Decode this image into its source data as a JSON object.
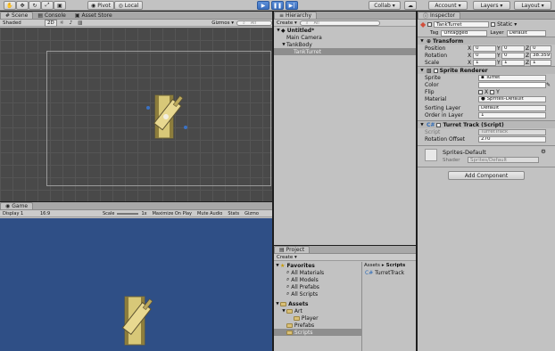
{
  "toolbar": {
    "pivot": "Pivot",
    "local": "Local",
    "collab": "Collab ▾",
    "account": "Account",
    "layers": "Layers",
    "layout": "Layout"
  },
  "scene": {
    "tab_scene": "Scene",
    "tab_console": "Console",
    "tab_asset_store": "Asset Store",
    "shading": "Shaded",
    "mode_2d": "2D",
    "gizmos": "Gizmos ▾",
    "search_placeholder": "All"
  },
  "game": {
    "tab": "Game",
    "display": "Display 1",
    "aspect": "16:9",
    "scale_label": "Scale",
    "scale_value": "1x",
    "maximize": "Maximize On Play",
    "mute": "Mute Audio",
    "stats": "Stats",
    "gizmos": "Gizmo"
  },
  "hierarchy": {
    "tab": "Hierarchy",
    "create": "Create ▾",
    "search_placeholder": "All",
    "scene_name": "Untitled*",
    "items": [
      {
        "label": "Main Camera"
      },
      {
        "label": "TankBody"
      },
      {
        "label": "TankTurret"
      }
    ]
  },
  "project": {
    "tab": "Project",
    "create": "Create ▾",
    "favorites": "Favorites",
    "favorite_items": [
      "All Materials",
      "All Models",
      "All Prefabs",
      "All Scripts"
    ],
    "assets": "Assets",
    "asset_items": [
      {
        "label": "Art",
        "level": 1
      },
      {
        "label": "Player",
        "level": 2
      },
      {
        "label": "Prefabs",
        "level": 1
      },
      {
        "label": "Scripts",
        "level": 1
      }
    ],
    "breadcrumb_root": "Assets",
    "breadcrumb_sep": "▸",
    "breadcrumb_leaf": "Scripts",
    "files": [
      "TurretTrack"
    ]
  },
  "inspector": {
    "tab": "Inspector",
    "object_name": "TankTurret",
    "static_label": "Static ▾",
    "tag_label": "Tag",
    "tag_value": "Untagged",
    "layer_label": "Layer",
    "layer_value": "Default",
    "transform": {
      "title": "Transform",
      "position_label": "Position",
      "rotation_label": "Rotation",
      "scale_label": "Scale",
      "axis_x": "X",
      "axis_y": "Y",
      "axis_z": "Z",
      "position": [
        "0",
        "0",
        "0"
      ],
      "rotation": [
        "0",
        "0",
        "38.359"
      ],
      "scale": [
        "1",
        "1",
        "1"
      ]
    },
    "sprite_renderer": {
      "title": "Sprite Renderer",
      "sprite_label": "Sprite",
      "sprite_value": "Turret",
      "color_label": "Color",
      "flip_label": "Flip",
      "flip_x": "X",
      "flip_y": "Y",
      "material_label": "Material",
      "material_value": "Sprites-Default",
      "sorting_layer_label": "Sorting Layer",
      "sorting_layer_value": "Default",
      "order_label": "Order in Layer",
      "order_value": "1"
    },
    "turret_track": {
      "title": "Turret Track (Script)",
      "script_label": "Script",
      "script_value": "TurretTrack",
      "offset_label": "Rotation Offset",
      "offset_value": "270"
    },
    "material": {
      "name": "Sprites-Default",
      "shader_label": "Shader",
      "shader_value": "Sprites/Default"
    },
    "add_component": "Add Component"
  },
  "colors": {
    "accent_blue": "#3a72c4",
    "panel": "#c2c2c2",
    "scene_bg": "#494949",
    "game_bg": "#2f4f86",
    "tank": "#d8c878"
  }
}
